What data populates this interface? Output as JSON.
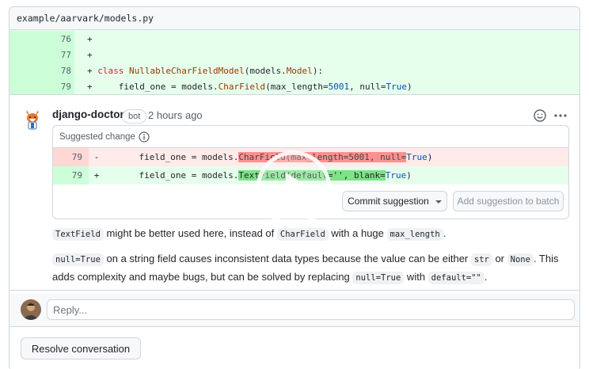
{
  "file": {
    "path": "example/aarvark/models.py"
  },
  "diff": {
    "lines": [
      {
        "num": "76",
        "sign": "+",
        "code": ""
      },
      {
        "num": "77",
        "sign": "+",
        "code": ""
      },
      {
        "num": "78",
        "sign": "+",
        "code_parts": [
          "class ",
          "NullableCharFieldModel",
          "(models.",
          "Model",
          "):"
        ]
      },
      {
        "num": "79",
        "sign": "+",
        "code_parts": [
          "    field_one = models.",
          "CharField",
          "(max_length=",
          "5001",
          ", null=",
          "True",
          ")"
        ]
      }
    ]
  },
  "comment": {
    "author": "django-doctor",
    "badge": "bot",
    "time": "2 hours ago",
    "suggestion": {
      "header": "Suggested change",
      "removed": {
        "num": "79",
        "sign": "-",
        "pre": "    field_one = models.",
        "hl": "CharField(max_length=5001, null=",
        "post_true": "True",
        "post": ")"
      },
      "added": {
        "num": "79",
        "sign": "+",
        "pre": "    field_one = models.",
        "hl": "TextField(default='', blank=",
        "post_true": "True",
        "post": ")"
      },
      "commit_label": "Commit suggestion",
      "batch_label": "Add suggestion to batch"
    },
    "para1": {
      "code1": "TextField",
      "t1": " might be better used here, instead of ",
      "code2": "CharField",
      "t2": " with a huge ",
      "code3": "max_length",
      "t3": "."
    },
    "para2": {
      "code1": "null=True",
      "t1": " on a string field causes inconsistent data types because the value can be either ",
      "code2": "str",
      "t2": " or ",
      "code3": "None",
      "t3": ". This",
      "t4": "adds complexity and maybe bugs, but can be solved by replacing ",
      "code4": "null=True",
      "t5": " with ",
      "code5": "default=\"\"",
      "t6": "."
    }
  },
  "reply": {
    "placeholder": "Reply..."
  },
  "resolve": {
    "label": "Resolve conversation"
  },
  "icons": {
    "emoji": "smiley-icon",
    "more": "kebab-horizontal-icon",
    "info": "info-icon",
    "play": "play-icon"
  }
}
